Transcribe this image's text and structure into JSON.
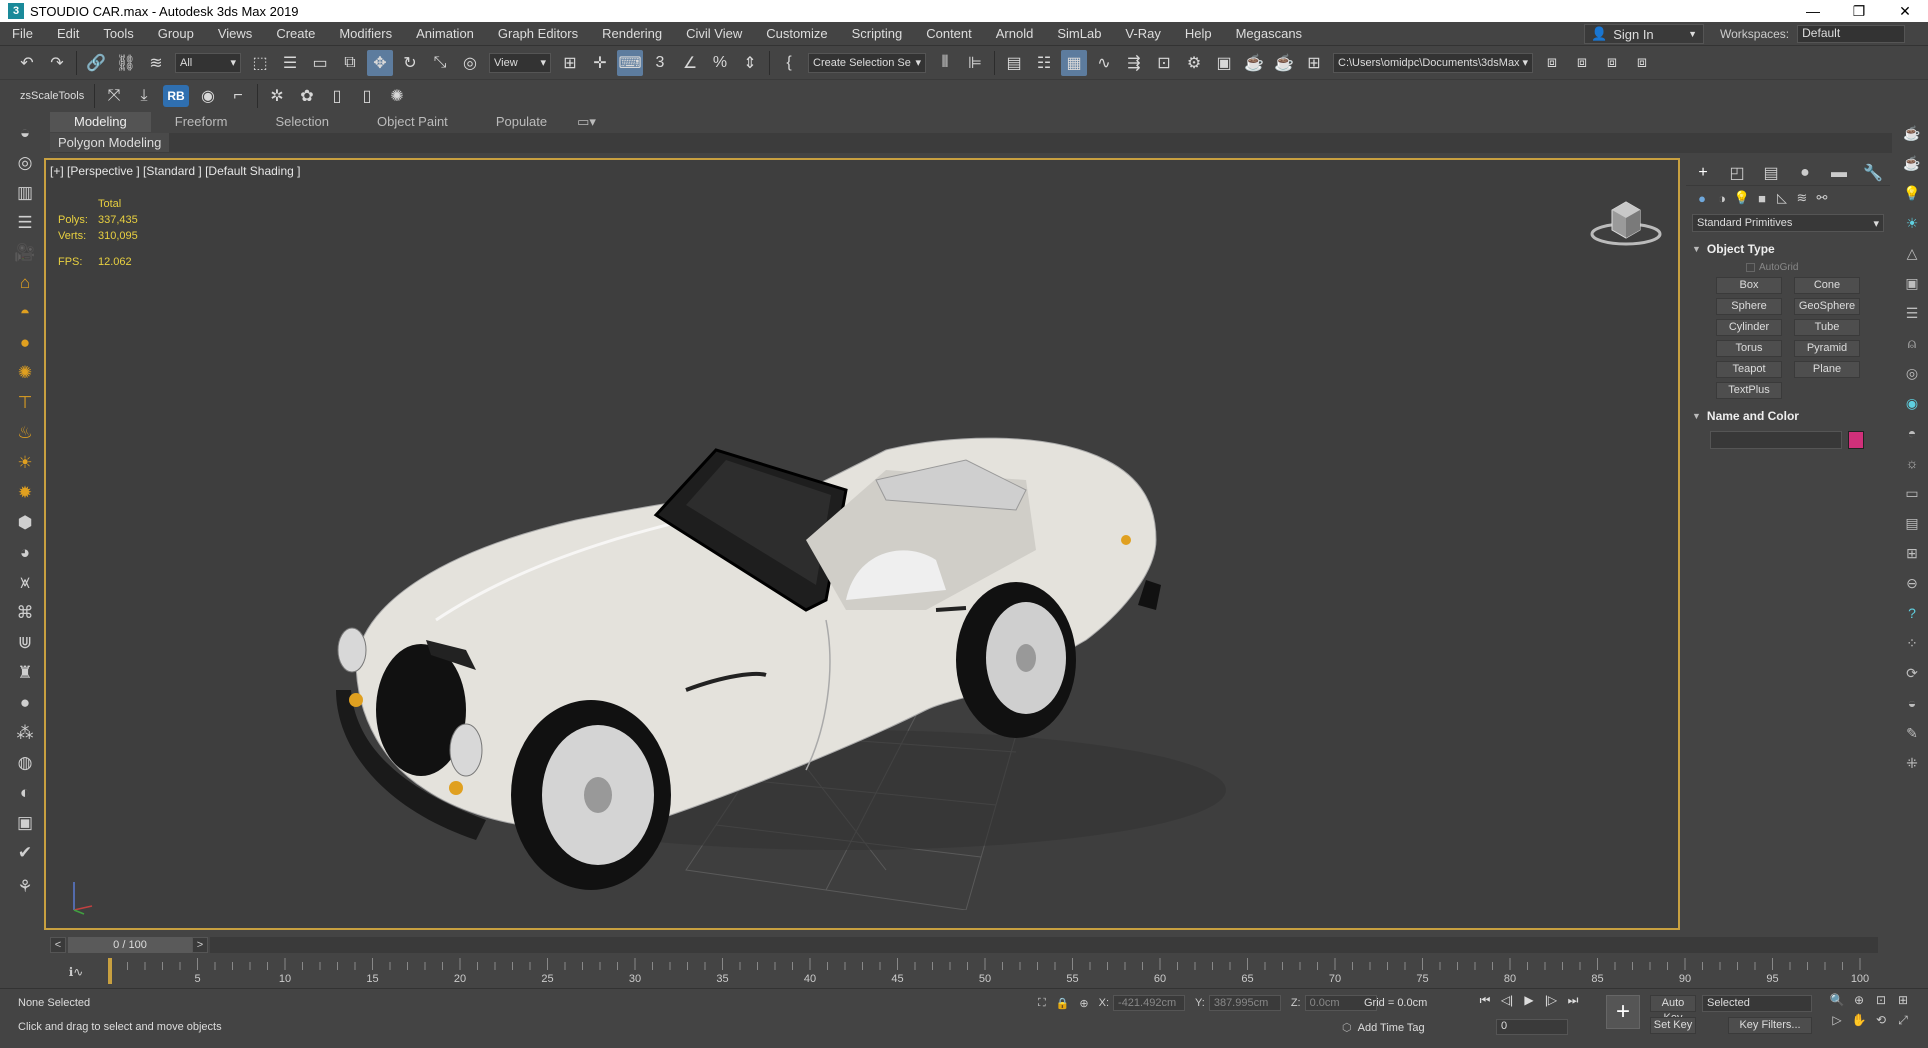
{
  "window": {
    "title": "STOUDIO  CAR.max - Autodesk 3ds Max 2019",
    "icon_letter": "3",
    "minimize": "—",
    "restore": "❐",
    "close": "✕"
  },
  "menu": [
    "File",
    "Edit",
    "Tools",
    "Group",
    "Views",
    "Create",
    "Modifiers",
    "Animation",
    "Graph Editors",
    "Rendering",
    "Civil View",
    "Customize",
    "Scripting",
    "Content",
    "Arnold",
    "SimLab",
    "V-Ray",
    "Help",
    "Megascans"
  ],
  "signin": {
    "label": "Sign In"
  },
  "workspaces": {
    "label": "Workspaces:",
    "value": "Default"
  },
  "toolbar": {
    "selection_filter": "All",
    "ref_coord": "View",
    "named_selection": "Create Selection Se",
    "project_path": "C:\\Users\\omidpc\\Documents\\3dsMax",
    "zsscale_label": "zsScaleTools",
    "rb_label": "RB"
  },
  "ribbon": {
    "tabs": [
      "Modeling",
      "Freeform",
      "Selection",
      "Object Paint",
      "Populate"
    ],
    "active_tab": "Modeling",
    "subpanel": "Polygon Modeling"
  },
  "viewport": {
    "label": "[+] [Perspective ] [Standard ] [Default Shading ]",
    "stats": {
      "total_label": "Total",
      "polys_label": "Polys:",
      "polys": "337,435",
      "verts_label": "Verts:",
      "verts": "310,095",
      "fps_label": "FPS:",
      "fps": "12.062"
    }
  },
  "command_panel": {
    "dropdown": "Standard Primitives",
    "object_type_title": "Object Type",
    "autogrid": "AutoGrid",
    "buttons": [
      "Box",
      "Cone",
      "Sphere",
      "GeoSphere",
      "Cylinder",
      "Tube",
      "Torus",
      "Pyramid",
      "Teapot",
      "Plane",
      "TextPlus"
    ],
    "name_color_title": "Name and Color",
    "swatch_color": "#d0307a"
  },
  "timeline": {
    "frame_display": "0 / 100",
    "prev": "<",
    "next": ">",
    "ticks": [
      "5",
      "10",
      "15",
      "20",
      "25",
      "30",
      "35",
      "40",
      "45",
      "50",
      "55",
      "60",
      "65",
      "70",
      "75",
      "80",
      "85",
      "90",
      "95",
      "100"
    ],
    "current_frame": 0,
    "total_frames": 100
  },
  "status": {
    "selection": "None Selected",
    "prompt": "Click and drag to select and move objects",
    "x_label": "X:",
    "x": "-421.492cm",
    "y_label": "Y:",
    "y": "387.995cm",
    "z_label": "Z:",
    "z": "0.0cm",
    "grid": "Grid = 0.0cm",
    "add_time_tag": "Add Time Tag",
    "frame_field": "0",
    "auto_key": "Auto Key",
    "set_key": "Set Key",
    "key_mode": "Selected",
    "key_filters": "Key Filters..."
  },
  "colors": {
    "viewport_border": "#c8a040",
    "stats_text": "#e8d040",
    "active_tool": "#5d7c9e"
  }
}
